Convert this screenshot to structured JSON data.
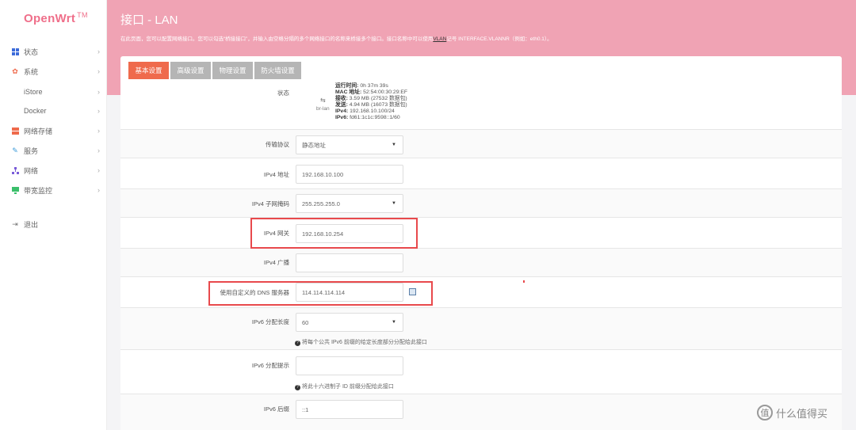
{
  "brand": {
    "name": "OpenWrt",
    "tm": "TM"
  },
  "nav": [
    {
      "label": "状态",
      "icon": "dashboard-icon",
      "color": "#3b6bd9"
    },
    {
      "label": "系统",
      "icon": "gear-icon",
      "color": "#ef6a4c"
    },
    {
      "label": "iStore",
      "icon": "",
      "color": ""
    },
    {
      "label": "Docker",
      "icon": "",
      "color": ""
    },
    {
      "label": "网络存储",
      "icon": "storage-icon",
      "color": "#ef6a4c"
    },
    {
      "label": "服务",
      "icon": "services-icon",
      "color": "#3b9bd9"
    },
    {
      "label": "网络",
      "icon": "network-icon",
      "color": "#7a5cd9"
    },
    {
      "label": "带宽监控",
      "icon": "monitor-icon",
      "color": "#3bbf6b"
    },
    {
      "label": "退出",
      "icon": "logout-icon",
      "color": "#777"
    }
  ],
  "page": {
    "title": "接口 - LAN",
    "desc_a": "在此页面，您可以配置网络接口。您可以勾选“桥接接口”，并输入由空格分隔的多个网络接口的名称来桥接多个接口。接口名称中可以使用",
    "desc_link": "VLAN",
    "desc_b": "记号 INTERFACE.VLANNR（例如：eth0.1）。"
  },
  "tabs": [
    "基本设置",
    "高级设置",
    "物理设置",
    "防火墙设置"
  ],
  "status": {
    "label": "状态",
    "iface": "br-lan",
    "lines": [
      {
        "k": "运行时间:",
        "v": "0h 37m 39s"
      },
      {
        "k": "MAC 地址:",
        "v": "52:54:00:30:29:EF"
      },
      {
        "k": "接收:",
        "v": "3.59 MB (27532 数据包)"
      },
      {
        "k": "发送:",
        "v": "4.94 MB (16073 数据包)"
      },
      {
        "k": "IPv4:",
        "v": "192.168.10.100/24"
      },
      {
        "k": "IPv6:",
        "v": "fd61:1c1c:9598::1/60"
      }
    ]
  },
  "fields": {
    "protocol": {
      "label": "传输协议",
      "value": "静态地址"
    },
    "ipv4_addr": {
      "label": "IPv4 地址",
      "value": "192.168.10.100"
    },
    "ipv4_mask": {
      "label": "IPv4 子网掩码",
      "value": "255.255.255.0"
    },
    "ipv4_gw": {
      "label": "IPv4 网关",
      "value": "192.168.10.254"
    },
    "ipv4_bcast": {
      "label": "IPv4 广播",
      "value": ""
    },
    "dns": {
      "label": "使用自定义的 DNS 服务器",
      "value": "114.114.114.114"
    },
    "ipv6_assign": {
      "label": "IPv6 分配长度",
      "value": "60",
      "hint": "将每个公共 IPv6 前缀的给定长度部分分配给此接口"
    },
    "ipv6_hint": {
      "label": "IPv6 分配提示",
      "value": "",
      "hint": "将此十六进制子 ID 前缀分配给此接口"
    },
    "ipv6_suffix": {
      "label": "IPv6 后缀",
      "value": "::1"
    }
  },
  "watermark": {
    "text": "什么值得买",
    "logo": "值"
  },
  "colors": {
    "accent": "#ef6a4c",
    "header": "#f0a3b4",
    "highlight": "#e8494c"
  }
}
